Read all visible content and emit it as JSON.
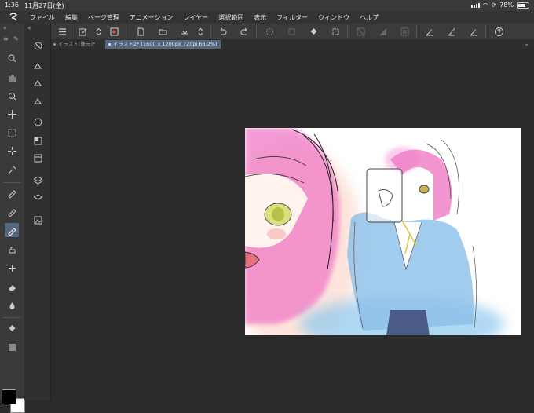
{
  "status_bar": {
    "time": "1:36",
    "date": "11月27日(金)",
    "battery": "78%",
    "battery_level": 0.78
  },
  "menu": {
    "items": [
      "ファイル",
      "編集",
      "ページ管理",
      "アニメーション",
      "レイヤー",
      "選択範囲",
      "表示",
      "フィルター",
      "ウィンドウ",
      "ヘルプ"
    ]
  },
  "tabs": [
    {
      "label": "イラスト[復元]*",
      "active": false
    },
    {
      "label": "イラスト2* (1600 x 1200px 72dpi 66.2%)",
      "active": true
    }
  ],
  "colors": {
    "main_color": "#000000",
    "sub_color": "#ffffff",
    "accent": "#55667f"
  },
  "icons": {
    "toolbar": [
      "menu-icon",
      "edit-icon",
      "stepper-icon",
      "new-file-icon",
      "open-icon",
      "save-icon",
      "undo-icon",
      "redo-icon",
      "loading-icon",
      "transform-icon",
      "fill-icon",
      "select-icon",
      "clear-icon",
      "pen-icon",
      "brush-icon",
      "airbrush-icon",
      "help-icon"
    ],
    "tools": [
      "zoom-icon",
      "hand-icon",
      "rotate-icon",
      "move-icon",
      "marquee-icon",
      "magic-wand-icon",
      "eyedropper-icon",
      "pen-icon",
      "pencil-icon",
      "brush-icon",
      "airbrush-icon",
      "decoration-icon",
      "eraser-icon",
      "blend-icon",
      "fill-icon",
      "gradient-icon"
    ]
  }
}
